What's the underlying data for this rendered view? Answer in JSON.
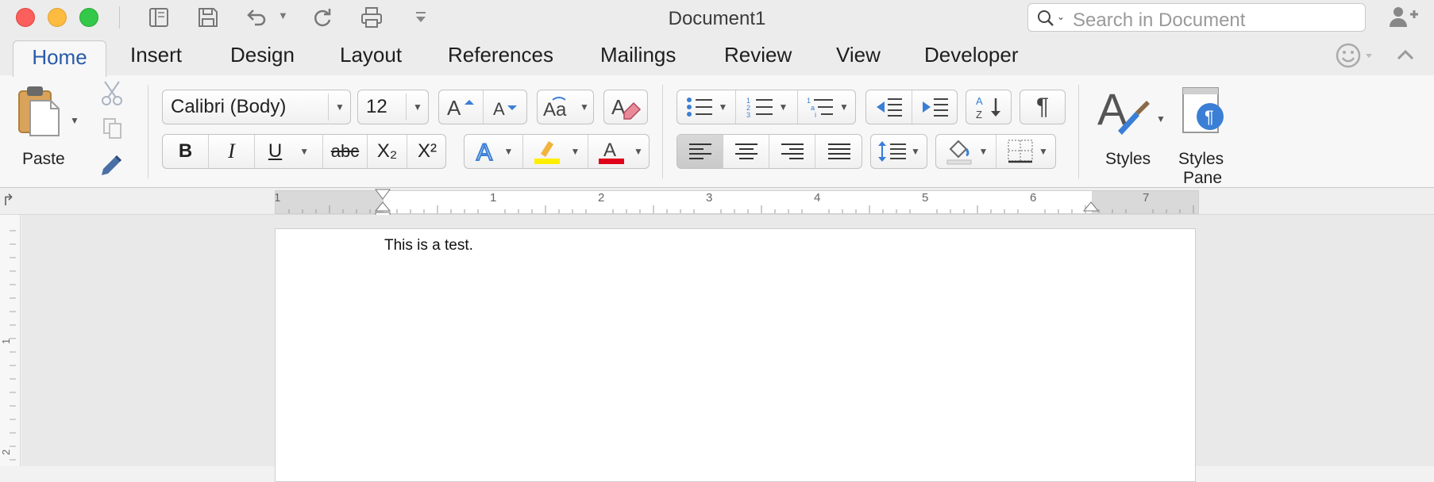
{
  "window": {
    "title": "Document1",
    "traffic_lights": {
      "close": "#fc605c",
      "minimize": "#fdbc40",
      "zoom": "#34c84a"
    }
  },
  "quick_access": [
    {
      "name": "sidebar-toggle-icon"
    },
    {
      "name": "save-icon"
    },
    {
      "name": "undo-icon"
    },
    {
      "name": "redo-icon"
    },
    {
      "name": "print-icon"
    },
    {
      "name": "customize-toolbar-icon"
    }
  ],
  "search": {
    "placeholder": "Search in Document",
    "value": ""
  },
  "tabs": [
    {
      "label": "Home",
      "active": true
    },
    {
      "label": "Insert"
    },
    {
      "label": "Design"
    },
    {
      "label": "Layout"
    },
    {
      "label": "References"
    },
    {
      "label": "Mailings"
    },
    {
      "label": "Review"
    },
    {
      "label": "View"
    },
    {
      "label": "Developer"
    }
  ],
  "ribbon": {
    "clipboard": {
      "paste_label": "Paste"
    },
    "font": {
      "font_name": "Calibri (Body)",
      "font_size": "12",
      "bold": "B",
      "italic": "I",
      "underline": "U",
      "strikethrough": "abc",
      "subscript": "X₂",
      "superscript": "X²",
      "highlight_color": "#ffee00",
      "font_color": "#e0001a"
    },
    "styles": {
      "styles_label": "Styles",
      "styles_pane_label_1": "Styles",
      "styles_pane_label_2": "Pane"
    },
    "accent": "#2a5aa8",
    "icon_blue": "#3a7fd5"
  },
  "ruler": {
    "horizontal": [
      "1",
      "1",
      "2",
      "3",
      "4",
      "5",
      "6",
      "7"
    ],
    "vertical": [
      "1",
      "2"
    ]
  },
  "document": {
    "text": "This is a test."
  }
}
